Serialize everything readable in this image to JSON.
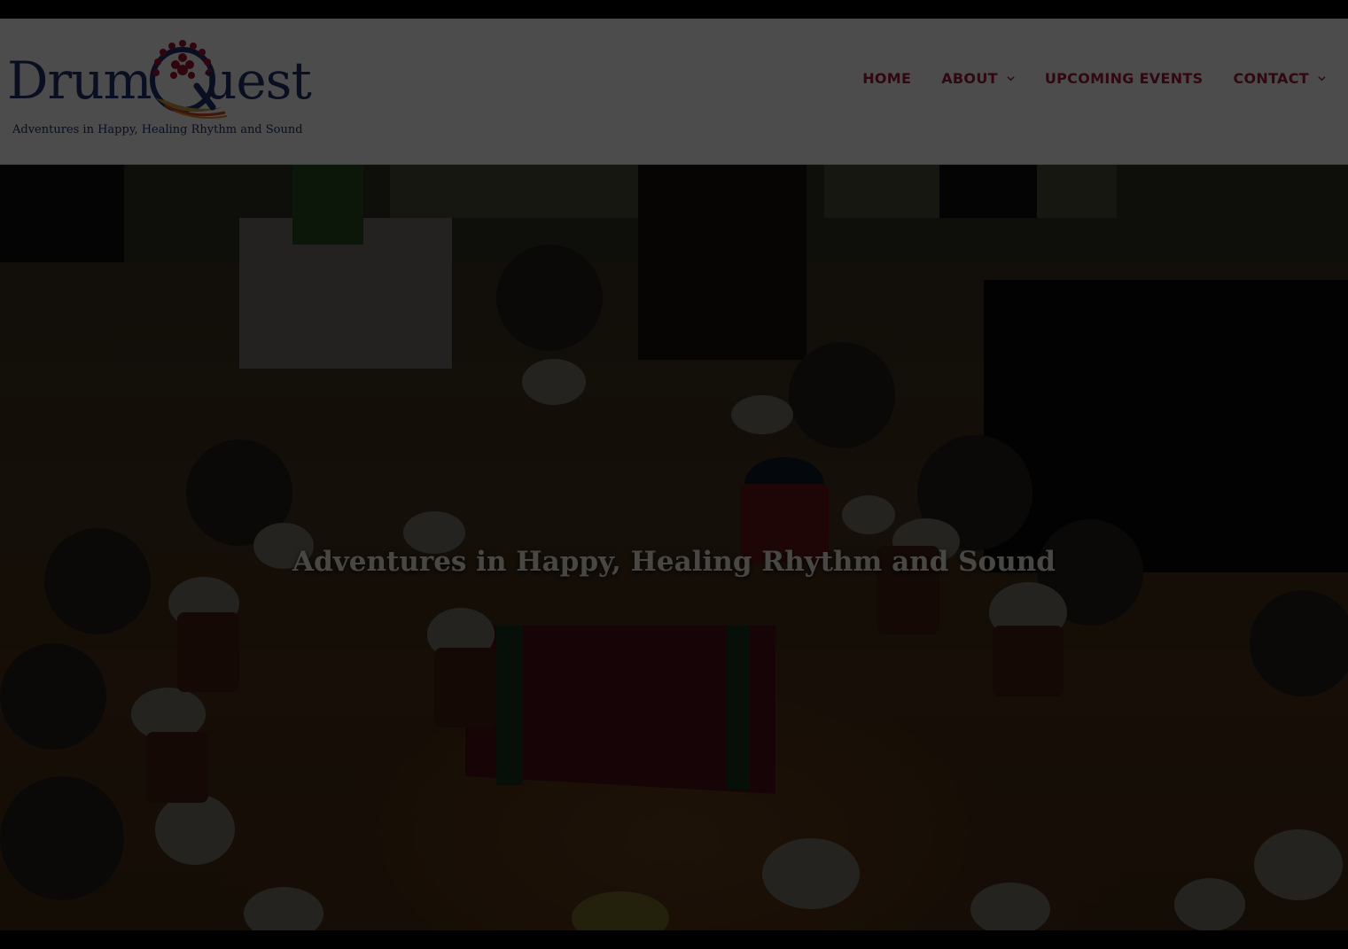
{
  "site": {
    "logo_part1": "Drum",
    "logo_part2": "uest",
    "tagline": "Adventures in Happy, Healing Rhythm and Sound"
  },
  "nav": {
    "items": [
      {
        "label": "HOME",
        "has_dropdown": false
      },
      {
        "label": "ABOUT",
        "has_dropdown": true
      },
      {
        "label": "UPCOMING EVENTS",
        "has_dropdown": false
      },
      {
        "label": "CONTACT",
        "has_dropdown": true
      }
    ]
  },
  "hero": {
    "title": "Adventures in Happy, Healing Rhythm and Sound"
  },
  "colors": {
    "nav_text": "#a5193a",
    "logo_navy": "#20306e",
    "logo_red": "#a3122c",
    "hero_title": "#f5eee3",
    "overlay": "rgba(0,0,0,0.70)"
  },
  "icons": {
    "dropdown": "chevron-down-icon",
    "emblem": "drum-emblem-icon"
  }
}
